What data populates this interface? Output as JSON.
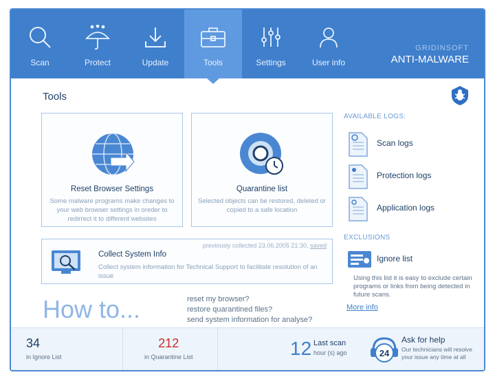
{
  "nav": {
    "items": [
      {
        "label": "Scan",
        "icon": "magnifier-icon"
      },
      {
        "label": "Protect",
        "icon": "umbrella-icon"
      },
      {
        "label": "Update",
        "icon": "download-icon"
      },
      {
        "label": "Tools",
        "icon": "toolbox-icon",
        "active": true
      },
      {
        "label": "Settings",
        "icon": "sliders-icon"
      },
      {
        "label": "User info",
        "icon": "user-icon"
      }
    ]
  },
  "brand": {
    "line1": "GRIDINSOFT",
    "line2": "ANTI-MALWARE"
  },
  "page_title": "Tools",
  "cards": {
    "reset": {
      "title": "Reset Browser Settings",
      "desc": "Some malware programs make changes to your web browser settings in oreder to redirrect it to different websites"
    },
    "quarantine": {
      "title": "Quarantine list",
      "desc": "Selected objects can be restored, deleted or copied to a safe location"
    },
    "collect": {
      "title": "Collect System Info",
      "desc": "Collect system information for Technical Support to facilitate resolution of an issue",
      "prev_text": "previously collected 23.06.2005 21:30,",
      "saved_link": "saved"
    }
  },
  "howto": {
    "title": "How to...",
    "links": [
      "reset my browser?",
      "restore quarantined files?",
      "send system information for analyse?"
    ]
  },
  "logs": {
    "heading": "AVAILABLE LOGS:",
    "items": [
      "Scan logs",
      "Protection logs",
      "Application logs"
    ]
  },
  "exclusions": {
    "heading": "EXCLUSIONS",
    "item": "Ignore list",
    "desc": "Using this list it is easy to exclude certain programs or links from being detected in future scans.",
    "more": "More info"
  },
  "footer": {
    "ignore_count": "34",
    "ignore_label": "in Ignore List",
    "quarantine_count": "212",
    "quarantine_label": "in Quarantine List",
    "last_scan_num": "12",
    "last_scan_label": "Last scan",
    "last_scan_unit": "hour (s) ago",
    "help_badge": "24",
    "help_title": "Ask for help",
    "help_desc": "Our technicians will resolve your issue any time at all"
  },
  "colors": {
    "header": "#3f7fcc",
    "active_tab": "#5f9ae0",
    "quarantine_count": "#c92a2a"
  }
}
